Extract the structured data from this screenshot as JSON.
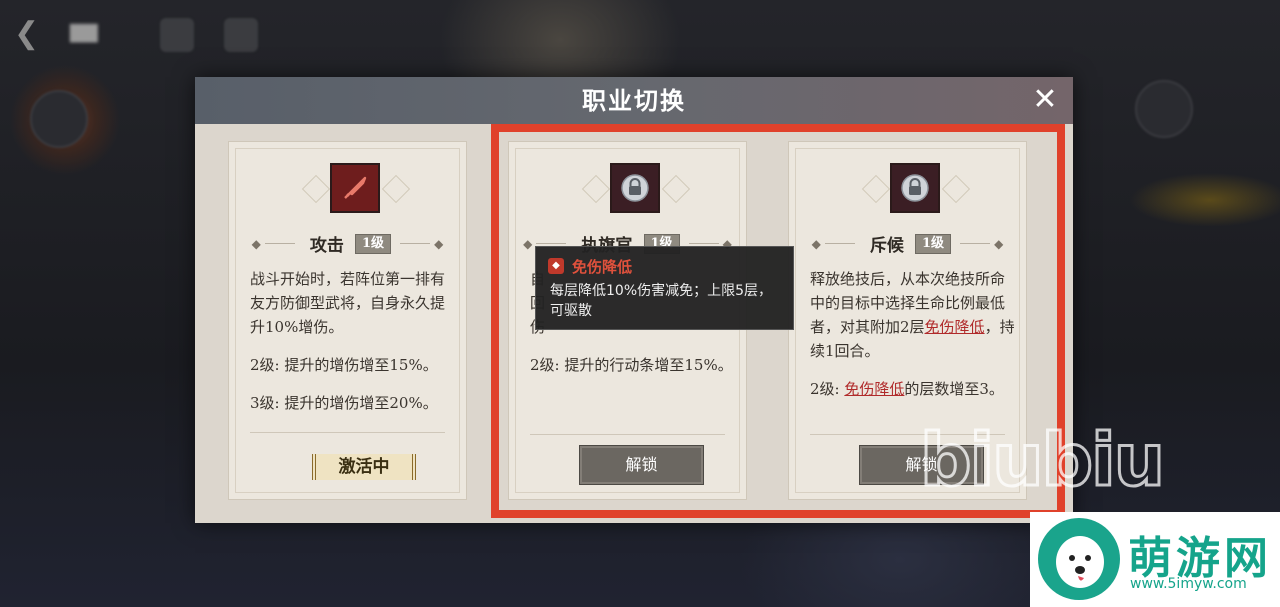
{
  "dialog": {
    "title": "职业切换",
    "close_glyph": "✕"
  },
  "cards": [
    {
      "name": "攻击",
      "level": "1级",
      "icon": "sword-icon",
      "locked": false,
      "desc": [
        "战斗开始时，若阵位第一排有友方防御型武将，自身永久提升10%增伤。",
        "2级: 提升的增伤增至15%。",
        "3级: 提升的增伤增至20%。"
      ],
      "status": "激活中"
    },
    {
      "name": "执旗官",
      "level": "1级",
      "icon": "lock-icon",
      "locked": true,
      "desc_line1_start": "自",
      "desc_line2_start": "回",
      "desc_line3_start": "伤",
      "desc_level2": "2级: 提升的行动条增至15%。",
      "button": "解锁"
    },
    {
      "name": "斥候",
      "level": "1级",
      "icon": "lock-icon",
      "locked": true,
      "desc_part1": "释放绝技后，从本次绝技所命中的目标中选择生命比例最低者，对其附加2层",
      "desc_kw1": "免伤降低",
      "desc_part2": "，持续1回合。",
      "desc_level2_prefix": "2级: ",
      "desc_level2_kw": "免伤降低",
      "desc_level2_suffix": "的层数增至3。",
      "button": "解锁"
    }
  ],
  "tooltip": {
    "title": "免伤降低",
    "text": "每层降低10%伤害减免；上限5层，可驱散"
  },
  "watermark": {
    "text": "biubiu",
    "site_name": "萌游网",
    "site_url": "www.5imyw.com"
  },
  "colors": {
    "highlight": "#e0412b",
    "keyword": "#b02a2a",
    "brand": "#15a48b"
  }
}
